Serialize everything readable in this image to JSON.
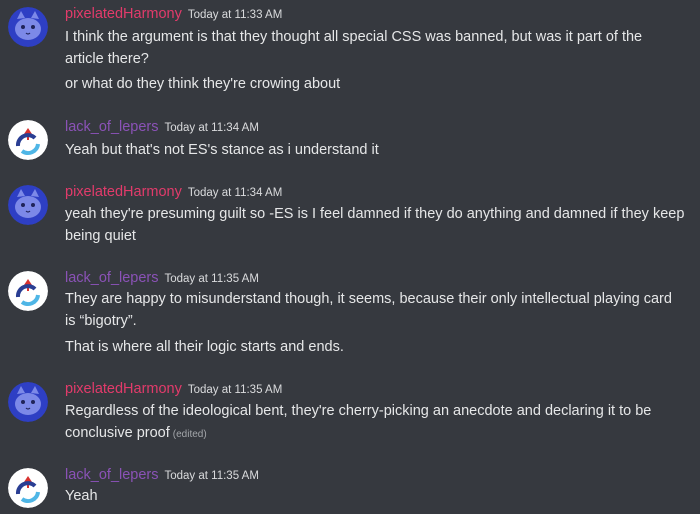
{
  "colors": {
    "background": "#36393f",
    "pixelatedHarmony": "#e23b6b",
    "lack_of_lepers": "#8a52b6",
    "text": "#e6e7e8"
  },
  "messages": [
    {
      "author": "pixelatedHarmony",
      "timestamp": "Today at 11:33 AM",
      "avatar": "blue-cat-avatar",
      "lines": [
        "I think the argument is that they thought all special CSS was banned, but was it part of the",
        "article there?",
        "or what do they think they're crowing about"
      ]
    },
    {
      "author": "lack_of_lepers",
      "timestamp": "Today at 11:34 AM",
      "avatar": "swirl-logo-avatar",
      "lines": [
        "Yeah but that's not ES's stance as i understand it"
      ]
    },
    {
      "author": "pixelatedHarmony",
      "timestamp": "Today at 11:34 AM",
      "avatar": "blue-cat-avatar",
      "lines": [
        "yeah they're presuming guilt so -ES is I feel damned if they do anything and damned if they keep",
        "being quiet"
      ]
    },
    {
      "author": "lack_of_lepers",
      "timestamp": "Today at 11:35 AM",
      "avatar": "swirl-logo-avatar",
      "lines": [
        "They are happy to misunderstand though, it seems, because their only intellectual playing card",
        "is “bigotry”.",
        "That is where all their logic starts and ends."
      ]
    },
    {
      "author": "pixelatedHarmony",
      "timestamp": "Today at 11:35 AM",
      "avatar": "blue-cat-avatar",
      "lines": [
        "Regardless of the ideological bent, they're cherry-picking an anecdote and declaring it to be",
        "conclusive proof"
      ],
      "edited_label": "(edited)"
    },
    {
      "author": "lack_of_lepers",
      "timestamp": "Today at 11:35 AM",
      "avatar": "swirl-logo-avatar",
      "lines": [
        "Yeah"
      ]
    }
  ]
}
